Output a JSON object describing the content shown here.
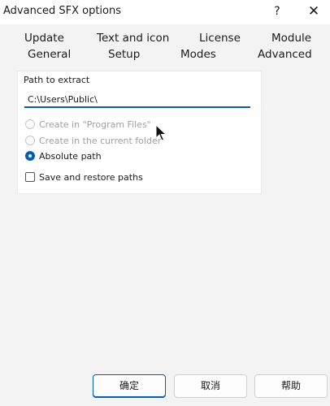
{
  "window": {
    "title": "Advanced SFX options",
    "help_label": "?",
    "close_label": "✕"
  },
  "tabs": {
    "row1": [
      "Update",
      "Text and icon",
      "License",
      "Module"
    ],
    "row2": [
      "General",
      "Setup",
      "Modes",
      "Advanced"
    ],
    "active": "General"
  },
  "general": {
    "path_label": "Path to extract",
    "path_value": "C:\\Users\\Public\\",
    "options": [
      {
        "label": "Create in \"Program Files\"",
        "enabled": false,
        "selected": false
      },
      {
        "label": "Create in the current folder",
        "enabled": false,
        "selected": false
      },
      {
        "label": "Absolute path",
        "enabled": true,
        "selected": true
      }
    ],
    "save_restore_label": "Save and restore paths",
    "save_restore_checked": false
  },
  "buttons": {
    "ok": "确定",
    "cancel": "取消",
    "help": "帮助"
  },
  "colors": {
    "accent": "#005fb8",
    "background": "#f3f3f3",
    "panel": "#ffffff"
  }
}
